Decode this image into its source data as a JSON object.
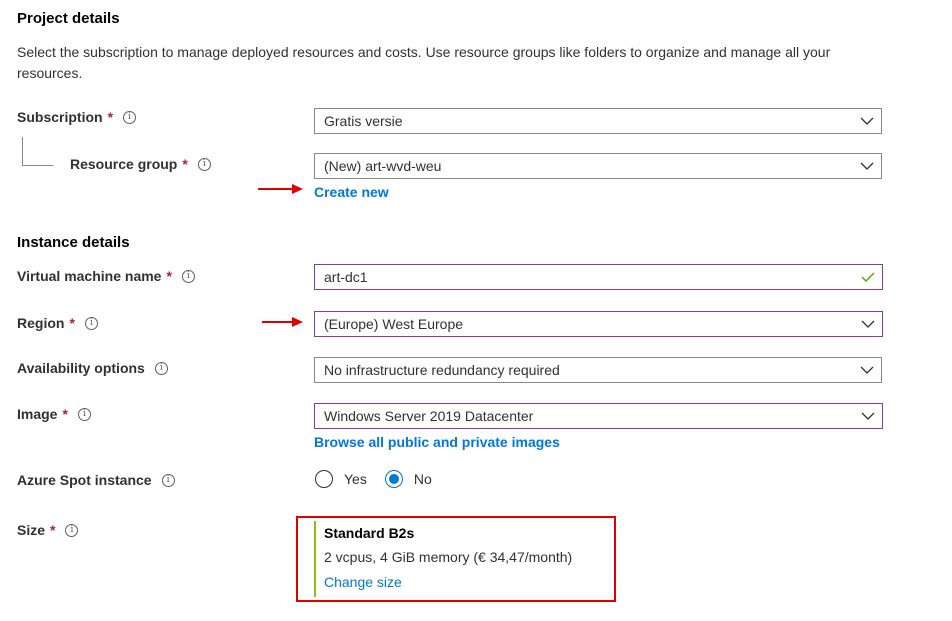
{
  "project": {
    "heading": "Project details",
    "description": "Select the subscription to manage deployed resources and costs. Use resource groups like folders to organize and manage all your resources.",
    "subscription_label": "Subscription",
    "subscription_value": "Gratis versie",
    "resource_group_label": "Resource group",
    "resource_group_value": "(New) art-wvd-weu",
    "create_new_link": "Create new"
  },
  "instance": {
    "heading": "Instance details",
    "vm_name_label": "Virtual machine name",
    "vm_name_value": "art-dc1",
    "region_label": "Region",
    "region_value": "(Europe) West Europe",
    "availability_label": "Availability options",
    "availability_value": "No infrastructure redundancy required",
    "image_label": "Image",
    "image_value": "Windows Server 2019 Datacenter",
    "browse_images_link": "Browse all public and private images",
    "spot_label": "Azure Spot instance",
    "spot_yes": "Yes",
    "spot_no": "No",
    "spot_selected": "No",
    "size_label": "Size",
    "size_name": "Standard B2s",
    "size_details": "2 vcpus, 4 GiB memory (€ 34,47/month)",
    "change_size_link": "Change size"
  },
  "common": {
    "required_mark": "*",
    "info_glyph": "i"
  },
  "colors": {
    "accent": "#0078d4",
    "required": "#a4262c",
    "annotation_red": "#e00000",
    "valid_check": "#57a300",
    "focus_border": "#7f3f9a"
  },
  "icons": {
    "dropdown": "chevron-down-icon",
    "info": "info-icon",
    "valid": "checkmark-icon"
  }
}
